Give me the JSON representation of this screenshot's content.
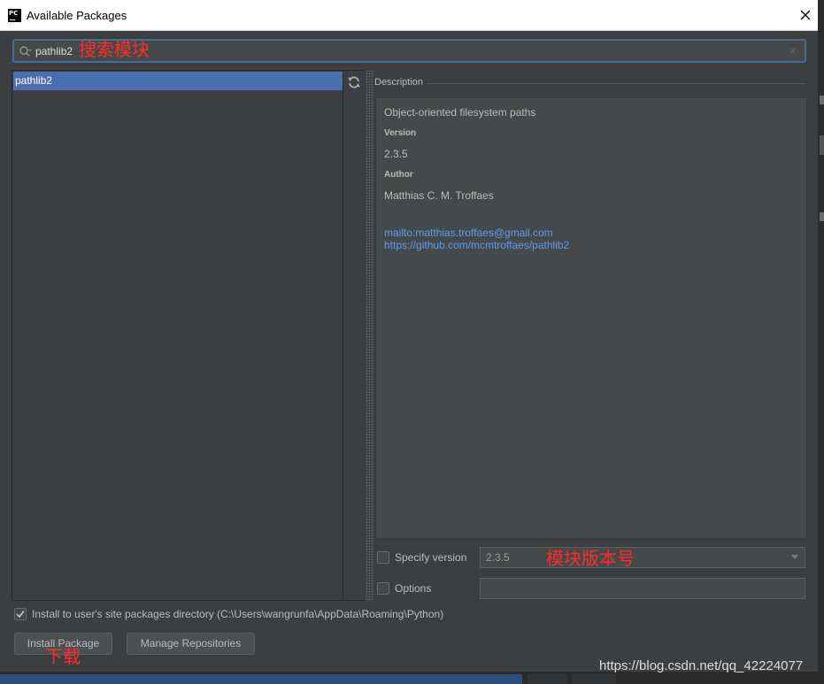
{
  "window": {
    "app_icon_text": "PC",
    "title": "Available Packages"
  },
  "search": {
    "value": "pathlib2",
    "annotation": "搜索模块"
  },
  "packages": {
    "items": [
      {
        "label": "pathlib2"
      }
    ]
  },
  "description": {
    "label": "Description",
    "summary": "Object-oriented filesystem paths",
    "version_heading": "Version",
    "version_value": "2.3.5",
    "author_heading": "Author",
    "author_value": "Matthias C. M. Troffaes",
    "links": [
      "mailto:matthias.troffaes@gmail.com",
      "https://github.com/mcmtroffaes/pathlib2"
    ]
  },
  "options": {
    "specify_version_label": "Specify version",
    "specify_version_checked": false,
    "version_select_value": "2.3.5",
    "version_annotation": "模块版本号",
    "options_label": "Options",
    "options_checked": false,
    "options_value": ""
  },
  "install_user": {
    "checked": true,
    "label": "Install to user's site packages directory (C:\\Users\\wangrunfa\\AppData\\Roaming\\Python)"
  },
  "buttons": {
    "install": "Install Package",
    "install_annotation": "下载",
    "manage": "Manage Repositories"
  },
  "watermark": "https://blog.csdn.net/qq_42224077",
  "colors": {
    "background": "#3c3f41",
    "selection": "#4b6eaf",
    "link": "#589df6",
    "annotation": "#ff2a2a",
    "focus_border": "#466d94"
  }
}
